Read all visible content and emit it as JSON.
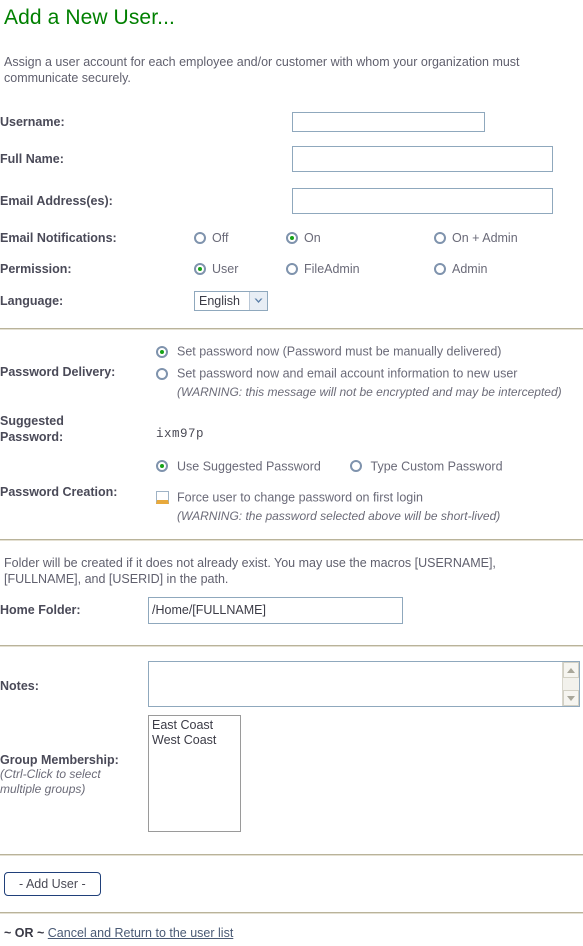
{
  "page": {
    "title": "Add a New User...",
    "intro": "Assign a user account for each employee and/or customer with whom your organization must communicate securely."
  },
  "fields": {
    "username": {
      "label": "Username:",
      "value": "",
      "placeholder": ""
    },
    "fullname": {
      "label": "Full Name:",
      "value": "",
      "placeholder": ""
    },
    "email": {
      "label": "Email Address(es):",
      "value": "",
      "placeholder": ""
    }
  },
  "email_notifications": {
    "label": "Email Notifications:",
    "options": [
      {
        "label": "Off",
        "selected": false
      },
      {
        "label": "On",
        "selected": true
      },
      {
        "label": "On + Admin",
        "selected": false
      }
    ]
  },
  "permission": {
    "label": "Permission:",
    "options": [
      {
        "label": "User",
        "selected": true
      },
      {
        "label": "FileAdmin",
        "selected": false
      },
      {
        "label": "Admin",
        "selected": false
      }
    ]
  },
  "language": {
    "label": "Language:",
    "value": "English",
    "options": [
      "English"
    ]
  },
  "password_delivery": {
    "label": "Password Delivery:",
    "options": [
      {
        "label": "Set password now (Password must be manually delivered)",
        "selected": true
      },
      {
        "label": "Set password now and email account information to new user",
        "selected": false
      }
    ],
    "warning": "(WARNING: this message will not be encrypted and may be intercepted)"
  },
  "suggested_password": {
    "label_line1": "Suggested",
    "label_line2": "Password:",
    "value": "ixm97p"
  },
  "password_creation": {
    "label": "Password Creation:",
    "options": [
      {
        "label": "Use Suggested Password",
        "selected": true
      },
      {
        "label": "Type Custom Password",
        "selected": false
      }
    ],
    "force_change": {
      "label": "Force user to change password on first login",
      "checked": false
    },
    "warning": "(WARNING: the password selected above will be short-lived)"
  },
  "home_folder": {
    "help": "Folder will be created if it does not already exist. You may use the macros [USERNAME], [FULLNAME], and [USERID] in the path.",
    "label": "Home Folder:",
    "value": "/Home/[FULLNAME]",
    "placeholder": ""
  },
  "notes": {
    "label": "Notes:",
    "value": "",
    "placeholder": ""
  },
  "group_membership": {
    "label": "Group Membership:",
    "hint_line1": "(Ctrl-Click to select",
    "hint_line2": "multiple groups)",
    "options": [
      {
        "label": "East Coast",
        "selected": false
      },
      {
        "label": "West Coast",
        "selected": false
      }
    ]
  },
  "actions": {
    "submit_label": "- Add User -",
    "or_prefix": "~ OR ~",
    "cancel_label": "Cancel and Return to the user list"
  },
  "colors": {
    "title_green": "#008000",
    "radio_dot_green": "#17a317",
    "checkbox_accent": "#e8a93c",
    "separator": "#b9b39a",
    "button_border": "#20407a"
  }
}
